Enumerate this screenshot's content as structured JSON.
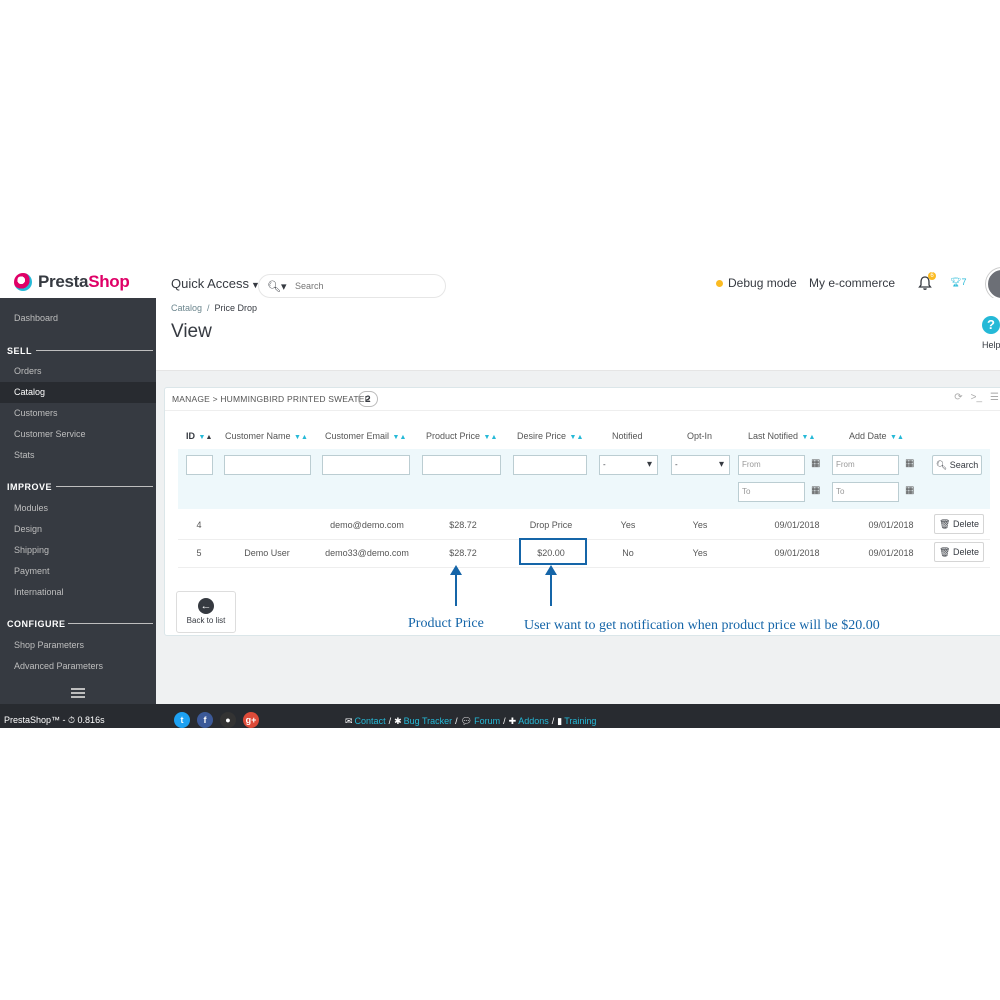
{
  "header": {
    "logo_prefix": "Presta",
    "logo_suffix": "Shop",
    "quick_access": "Quick Access",
    "search_placeholder": "Search",
    "debug_mode": "Debug mode",
    "shop_name": "My e-commerce",
    "notifications_count": "6",
    "trophy_count": "7"
  },
  "sidebar": {
    "dashboard": "Dashboard",
    "sell": "SELL",
    "orders": "Orders",
    "catalog": "Catalog",
    "customers": "Customers",
    "customer_service": "Customer Service",
    "stats": "Stats",
    "improve": "IMPROVE",
    "modules": "Modules",
    "design": "Design",
    "shipping": "Shipping",
    "payment": "Payment",
    "international": "International",
    "configure": "CONFIGURE",
    "shop_parameters": "Shop Parameters",
    "advanced_parameters": "Advanced Parameters"
  },
  "page": {
    "breadcrumb_parent": "Catalog",
    "breadcrumb_current": "Price Drop",
    "title": "View",
    "help": "Help"
  },
  "panel": {
    "title": "MANAGE > HUMMINGBIRD PRINTED SWEATER",
    "count": "2",
    "columns": {
      "id": "ID",
      "customer_name": "Customer Name",
      "customer_email": "Customer Email",
      "product_price": "Product Price",
      "desire_price": "Desire Price",
      "notified": "Notified",
      "opt_in": "Opt-In",
      "last_notified": "Last Notified",
      "add_date": "Add Date"
    },
    "filters": {
      "select_default": "-",
      "from": "From",
      "to": "To",
      "search_button": "Search"
    },
    "rows": [
      {
        "id": "4",
        "name": "",
        "email": "demo@demo.com",
        "product_price": "$28.72",
        "desire_price": "Drop Price",
        "notified": "Yes",
        "opt_in": "Yes",
        "last_notified": "09/01/2018",
        "add_date": "09/01/2018",
        "action": "Delete"
      },
      {
        "id": "5",
        "name": "Demo User",
        "email": "demo33@demo.com",
        "product_price": "$28.72",
        "desire_price": "$20.00",
        "notified": "No",
        "opt_in": "Yes",
        "last_notified": "09/01/2018",
        "add_date": "09/01/2018",
        "action": "Delete"
      }
    ],
    "back_to_list": "Back to list"
  },
  "annotations": {
    "product_price": "Product Price",
    "user_note": "User want to get notification when product price will be $20.00"
  },
  "footer": {
    "version": "PrestaShop™ - ⏱ 0.816s",
    "contact": "Contact",
    "bug_tracker": "Bug Tracker",
    "forum": "Forum",
    "addons": "Addons",
    "training": "Training"
  },
  "colors": {
    "primary": "#25b9d7",
    "sidebar": "#363a41",
    "annotation": "#1565a8",
    "brand_pink": "#df0067"
  }
}
